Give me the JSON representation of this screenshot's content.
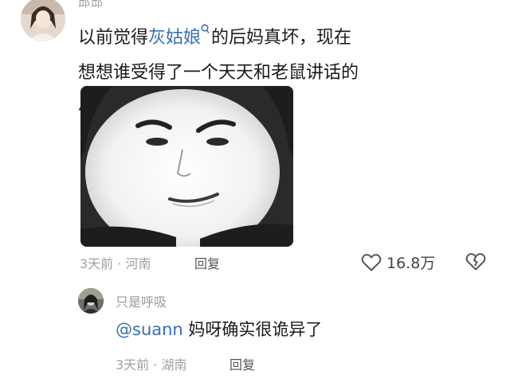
{
  "comment": {
    "username": "邱邱",
    "text_before": "以前觉得",
    "keyword": "灰姑娘",
    "text_after": "的后妈真坏，现在想想谁受得了一个天天和老鼠讲话的小孩",
    "emoji": "crying-face-icon",
    "time": "3天前",
    "separator": "·",
    "location": "河南",
    "reply_label": "回复",
    "like_count": "16.8万"
  },
  "reply": {
    "username": "只是呼吸",
    "mention": "@suann",
    "text": " 妈呀确实很诡异了",
    "time": "3天前",
    "separator": "·",
    "location": "湖南",
    "reply_label": "回复"
  },
  "colors": {
    "keyword": "#3a6fb0",
    "meta": "#a0a0a0",
    "text": "#1a1a1a"
  }
}
